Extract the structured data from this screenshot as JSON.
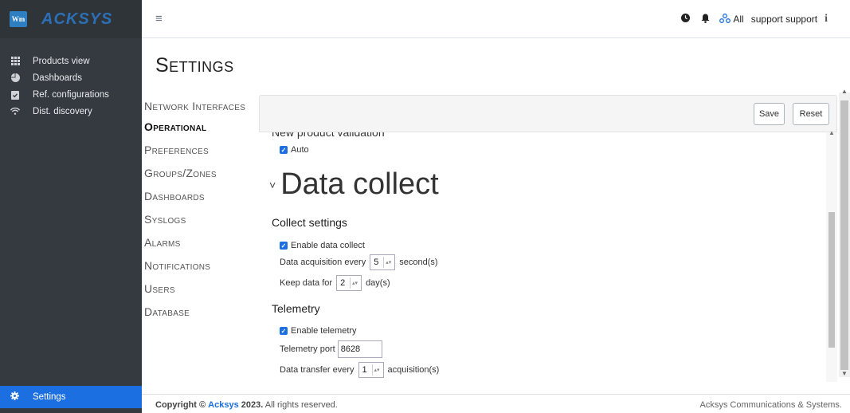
{
  "app": {
    "logo_badge": "Wm",
    "logo_text": "ACKSYS"
  },
  "sidebar": {
    "items": [
      {
        "label": "Products view",
        "icon": "grid-icon"
      },
      {
        "label": "Dashboards",
        "icon": "pie-chart-icon"
      },
      {
        "label": "Ref. configurations",
        "icon": "clipboard-check-icon"
      },
      {
        "label": "Dist. discovery",
        "icon": "wifi-icon"
      }
    ],
    "settings_label": "Settings"
  },
  "topbar": {
    "group_label": "All",
    "user_label": "support support",
    "info_glyph": "i"
  },
  "page": {
    "title": "Settings"
  },
  "sections": [
    {
      "label": "Network Interfaces",
      "active": false
    },
    {
      "label": "Operational",
      "active": true
    },
    {
      "label": "Preferences",
      "active": false
    },
    {
      "label": "Groups/Zones",
      "active": false
    },
    {
      "label": "Dashboards",
      "active": false
    },
    {
      "label": "Syslogs",
      "active": false
    },
    {
      "label": "Alarms",
      "active": false
    },
    {
      "label": "Notifications",
      "active": false
    },
    {
      "label": "Users",
      "active": false
    },
    {
      "label": "Database",
      "active": false
    }
  ],
  "panel": {
    "save_label": "Save",
    "reset_label": "Reset",
    "cut_title": "New product validation",
    "auto_label": "Auto",
    "data_collect_title": "Data collect",
    "collect_settings_title": "Collect settings",
    "enable_collect_label": "Enable data collect",
    "acquisition_prefix": "Data acquisition every",
    "acquisition_value": "5",
    "acquisition_suffix": "second(s)",
    "keep_prefix": "Keep data for",
    "keep_value": "2",
    "keep_suffix": "day(s)",
    "telemetry_title": "Telemetry",
    "enable_telemetry_label": "Enable telemetry",
    "telemetry_port_label": "Telemetry port",
    "telemetry_port_value": "8628",
    "transfer_prefix": "Data transfer every",
    "transfer_value": "1",
    "transfer_suffix": "acquisition(s)"
  },
  "footer": {
    "copyright_prefix": "Copyright ©",
    "brand": "Acksys",
    "year": "2023.",
    "rights": "All rights reserved.",
    "company": "Acksys Communications & Systems."
  },
  "colors": {
    "accent": "#1b6fe0",
    "sidebar_bg": "#343a40"
  }
}
